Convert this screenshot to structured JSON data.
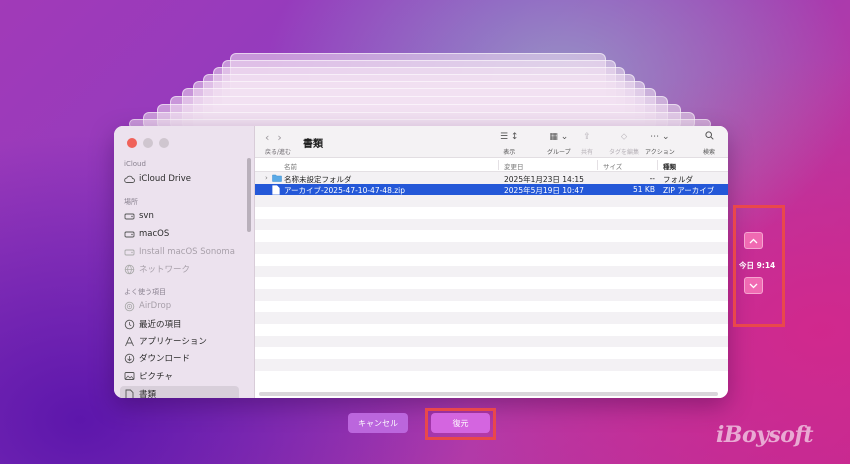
{
  "finder": {
    "folder_title": "書類",
    "nav_label": "戻る/進む",
    "toolbar": {
      "view": "表示",
      "group": "グループ",
      "share": "共有",
      "tags": "タグを編集",
      "action": "アクション",
      "search": "検索"
    },
    "sidebar": {
      "icloud_header": "iCloud",
      "icloud_drive": "iCloud Drive",
      "locations_header": "場所",
      "locations": [
        "svn",
        "macOS",
        "Install macOS Sonoma",
        "ネットワーク"
      ],
      "favorites_header": "よく使う項目",
      "favorites": [
        "AirDrop",
        "最近の項目",
        "アプリケーション",
        "ダウンロード",
        "ピクチャ",
        "書類"
      ]
    },
    "columns": {
      "name": "名前",
      "date": "変更日",
      "size": "サイズ",
      "kind": "種類"
    },
    "rows": [
      {
        "name": "名称未設定フォルダ",
        "date": "2025年1月23日 14:15",
        "size": "--",
        "kind": "フォルダ"
      },
      {
        "name": "アーカイブ-2025-47-10-47-48.zip",
        "date": "2025年5月19日 10:47",
        "size": "51 KB",
        "kind": "ZIP アーカイブ"
      }
    ]
  },
  "time_nav": {
    "current": "今日 9:14"
  },
  "buttons": {
    "cancel": "キャンセル",
    "restore": "復元"
  },
  "brand": "iBoysoft",
  "colors": {
    "accent": "#2458d8",
    "highlight": "#e9484b",
    "button": "#d465e0"
  }
}
